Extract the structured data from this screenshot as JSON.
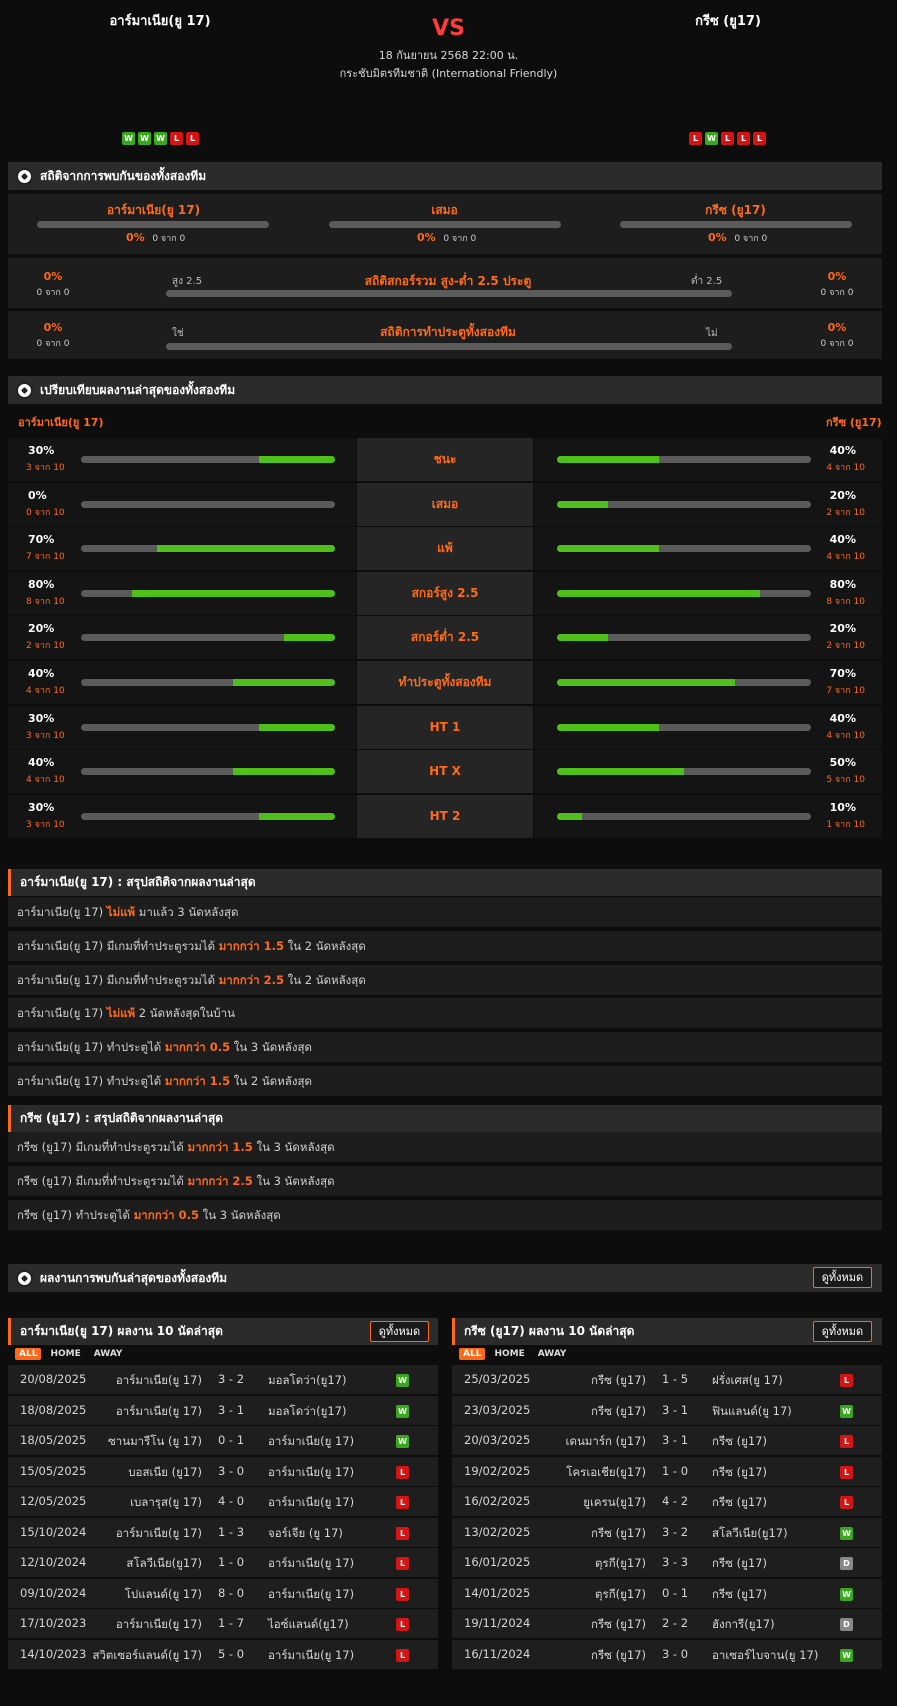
{
  "header": {
    "home_team": "อาร์มาเนีย(ยู 17)",
    "away_team": "กรีซ (ยู17)",
    "vs": "VS",
    "date": "18 กันยายน 2568 22:00 น.",
    "competition": "กระชับมิตรทีมชาติ (International Friendly)",
    "home_form": [
      "W",
      "W",
      "W",
      "L",
      "L"
    ],
    "away_form": [
      "L",
      "W",
      "L",
      "L",
      "L"
    ]
  },
  "h2h_stats": {
    "title": "สถิติจากการพบกันของทั้งสองทีม",
    "home": {
      "label": "อาร์มาเนีย(ยู 17)",
      "pct": "0%",
      "count": "0 จาก 0"
    },
    "draw": {
      "label": "เสมอ",
      "pct": "0%",
      "count": "0 จาก 0"
    },
    "away": {
      "label": "กรีซ (ยู17)",
      "pct": "0%",
      "count": "0 จาก 0"
    },
    "over_under": {
      "title": "สถิติสกอร์รวม สูง-ต่ำ 2.5 ประตู",
      "left_label": "สูง 2.5",
      "right_label": "ต่ำ 2.5",
      "left_pct": "0%",
      "left_count": "0 จาก 0",
      "right_pct": "0%",
      "right_count": "0 จาก 0"
    },
    "btts": {
      "title": "สถิติการทำประตูทั้งสองทีม",
      "left_label": "ใช่",
      "right_label": "ไม่",
      "left_pct": "0%",
      "left_count": "0 จาก 0",
      "right_pct": "0%",
      "right_count": "0 จาก 0"
    }
  },
  "compare": {
    "title": "เปรียบเทียบผลงานล่าสุดของทั้งสองทีม",
    "home_label": "อาร์มาเนีย(ยู 17)",
    "away_label": "กรีซ (ยู17)",
    "rows": [
      {
        "label": "ชนะ",
        "home_pct": "30%",
        "home_count": "3 จาก 10",
        "home_value": 0.3,
        "away_pct": "40%",
        "away_count": "4 จาก 10",
        "away_value": 0.4
      },
      {
        "label": "เสมอ",
        "home_pct": "0%",
        "home_count": "0 จาก 10",
        "home_value": 0.0,
        "away_pct": "20%",
        "away_count": "2 จาก 10",
        "away_value": 0.2
      },
      {
        "label": "แพ้",
        "home_pct": "70%",
        "home_count": "7 จาก 10",
        "home_value": 0.7,
        "away_pct": "40%",
        "away_count": "4 จาก 10",
        "away_value": 0.4
      },
      {
        "label": "สกอร์สูง 2.5",
        "home_pct": "80%",
        "home_count": "8 จาก 10",
        "home_value": 0.8,
        "away_pct": "80%",
        "away_count": "8 จาก 10",
        "away_value": 0.8
      },
      {
        "label": "สกอร์ต่ำ 2.5",
        "home_pct": "20%",
        "home_count": "2 จาก 10",
        "home_value": 0.2,
        "away_pct": "20%",
        "away_count": "2 จาก 10",
        "away_value": 0.2
      },
      {
        "label": "ทำประตูทั้งสองทีม",
        "home_pct": "40%",
        "home_count": "4 จาก 10",
        "home_value": 0.4,
        "away_pct": "70%",
        "away_count": "7 จาก 10",
        "away_value": 0.7
      },
      {
        "label": "HT 1",
        "home_pct": "30%",
        "home_count": "3 จาก 10",
        "home_value": 0.3,
        "away_pct": "40%",
        "away_count": "4 จาก 10",
        "away_value": 0.4
      },
      {
        "label": "HT X",
        "home_pct": "40%",
        "home_count": "4 จาก 10",
        "home_value": 0.4,
        "away_pct": "50%",
        "away_count": "5 จาก 10",
        "away_value": 0.5
      },
      {
        "label": "HT 2",
        "home_pct": "30%",
        "home_count": "3 จาก 10",
        "home_value": 0.3,
        "away_pct": "10%",
        "away_count": "1 จาก 10",
        "away_value": 0.1
      }
    ]
  },
  "home_summary": {
    "title": "อาร์มาเนีย(ยู 17) : สรุปสถิติจากผลงานล่าสุด",
    "rows": [
      {
        "team": "อาร์มาเนีย(ยู 17)",
        "pre": "",
        "hl": "ไม่แพ้",
        "post": "มาแล้ว 3 นัดหลังสุด"
      },
      {
        "team": "อาร์มาเนีย(ยู 17)",
        "pre": "มีเกมที่ทำประตูรวมได้",
        "hl": "มากกว่า  1.5",
        "post": "ใน 2 นัดหลังสุด"
      },
      {
        "team": "อาร์มาเนีย(ยู 17)",
        "pre": "มีเกมที่ทำประตูรวมได้",
        "hl": "มากกว่า  2.5",
        "post": "ใน 2 นัดหลังสุด"
      },
      {
        "team": "อาร์มาเนีย(ยู 17)",
        "pre": "",
        "hl": "ไม่แพ้",
        "post": " 2  นัดหลังสุดในบ้าน"
      },
      {
        "team": "อาร์มาเนีย(ยู 17)",
        "pre": "ทำประตูได้",
        "hl": "มากกว่า  0.5",
        "post": "ใน 3 นัดหลังสุด"
      },
      {
        "team": "อาร์มาเนีย(ยู 17)",
        "pre": "ทำประตูได้",
        "hl": "มากกว่า  1.5",
        "post": "ใน 2 นัดหลังสุด"
      }
    ]
  },
  "away_summary": {
    "title": "กรีซ (ยู17) : สรุปสถิติจากผลงานล่าสุด",
    "rows": [
      {
        "team": "กรีซ (ยู17)",
        "pre": "มีเกมที่ทำประตูรวมได้",
        "hl": "มากกว่า  1.5",
        "post": "ใน 3 นัดหลังสุด"
      },
      {
        "team": "กรีซ (ยู17)",
        "pre": "มีเกมที่ทำประตูรวมได้",
        "hl": "มากกว่า  2.5",
        "post": "ใน 3 นัดหลังสุด"
      },
      {
        "team": "กรีซ (ยู17)",
        "pre": "ทำประตูได้",
        "hl": "มากกว่า  0.5",
        "post": "ใน 3 นัดหลังสุด"
      }
    ]
  },
  "h2h_results": {
    "title": "ผลงานการพบกันล่าสุดของทั้งสองทีม",
    "view_all": "ดูทั้งหมด"
  },
  "home_last10": {
    "title": "อาร์มาเนีย(ยู 17) ผลงาน 10 นัดล่าสุด",
    "view_all": "ดูทั้งหมด",
    "tabs": [
      "ALL",
      "HOME",
      "AWAY"
    ],
    "matches": [
      {
        "date": "20/08/2025",
        "home": "อาร์มาเนีย(ยู 17)",
        "score": "3 - 2",
        "away": "มอลโดว่า(ยู17)",
        "result": "W"
      },
      {
        "date": "18/08/2025",
        "home": "อาร์มาเนีย(ยู 17)",
        "score": "3 - 1",
        "away": "มอลโดว่า(ยู17)",
        "result": "W"
      },
      {
        "date": "18/05/2025",
        "home": "ซานมารีโน (ยู 17)",
        "score": "0 - 1",
        "away": "อาร์มาเนีย(ยู 17)",
        "result": "W"
      },
      {
        "date": "15/05/2025",
        "home": "บอสเนีย (ยู17)",
        "score": "3 - 0",
        "away": "อาร์มาเนีย(ยู 17)",
        "result": "L"
      },
      {
        "date": "12/05/2025",
        "home": "เบลารุส(ยู 17)",
        "score": "4 - 0",
        "away": "อาร์มาเนีย(ยู 17)",
        "result": "L"
      },
      {
        "date": "15/10/2024",
        "home": "อาร์มาเนีย(ยู 17)",
        "score": "1 - 3",
        "away": "จอร์เจีย (ยู 17)",
        "result": "L"
      },
      {
        "date": "12/10/2024",
        "home": "สโลวีเนีย(ยู17)",
        "score": "1 - 0",
        "away": "อาร์มาเนีย(ยู 17)",
        "result": "L"
      },
      {
        "date": "09/10/2024",
        "home": "โปแลนด์(ยู 17)",
        "score": "8 - 0",
        "away": "อาร์มาเนีย(ยู 17)",
        "result": "L"
      },
      {
        "date": "17/10/2023",
        "home": "อาร์มาเนีย(ยู 17)",
        "score": "1 - 7",
        "away": "ไอซ์แลนด์(ยู17)",
        "result": "L"
      },
      {
        "date": "14/10/2023",
        "home": "สวิตเซอร์แลนด์(ยู 17)",
        "score": "5 - 0",
        "away": "อาร์มาเนีย(ยู 17)",
        "result": "L"
      }
    ]
  },
  "away_last10": {
    "title": "กรีซ (ยู17) ผลงาน 10 นัดล่าสุด",
    "view_all": "ดูทั้งหมด",
    "tabs": [
      "ALL",
      "HOME",
      "AWAY"
    ],
    "matches": [
      {
        "date": "25/03/2025",
        "home": "กรีซ (ยู17)",
        "score": "1 - 5",
        "away": "ฝรั่งเศส(ยู 17)",
        "result": "L"
      },
      {
        "date": "23/03/2025",
        "home": "กรีซ (ยู17)",
        "score": "3 - 1",
        "away": "ฟินแลนด์(ยู 17)",
        "result": "W"
      },
      {
        "date": "20/03/2025",
        "home": "เดนมาร์ก (ยู17)",
        "score": "3 - 1",
        "away": "กรีซ (ยู17)",
        "result": "L"
      },
      {
        "date": "19/02/2025",
        "home": "โครเอเชีย(ยู17)",
        "score": "1 - 0",
        "away": "กรีซ (ยู17)",
        "result": "L"
      },
      {
        "date": "16/02/2025",
        "home": "ยูเครน(ยู17)",
        "score": "4 - 2",
        "away": "กรีซ (ยู17)",
        "result": "L"
      },
      {
        "date": "13/02/2025",
        "home": "กรีซ (ยู17)",
        "score": "3 - 2",
        "away": "สโลวีเนีย(ยู17)",
        "result": "W"
      },
      {
        "date": "16/01/2025",
        "home": "ตุรกี(ยู17)",
        "score": "3 - 3",
        "away": "กรีซ (ยู17)",
        "result": "D"
      },
      {
        "date": "14/01/2025",
        "home": "ตุรกี(ยู17)",
        "score": "0 - 1",
        "away": "กรีซ (ยู17)",
        "result": "W"
      },
      {
        "date": "19/11/2024",
        "home": "กรีซ (ยู17)",
        "score": "2 - 2",
        "away": "ฮังการี(ยู17)",
        "result": "D"
      },
      {
        "date": "16/11/2024",
        "home": "กรีซ (ยู17)",
        "score": "3 - 0",
        "away": "อาเซอร์ไบจาน(ยู 17)",
        "result": "W"
      }
    ]
  },
  "colors": {
    "accent": "#ff6a1a",
    "win": "#3aa81f",
    "loss": "#d41515",
    "draw": "#888888",
    "bar_fill": "#4fbf1a",
    "bar_track": "#5b5b5b"
  }
}
